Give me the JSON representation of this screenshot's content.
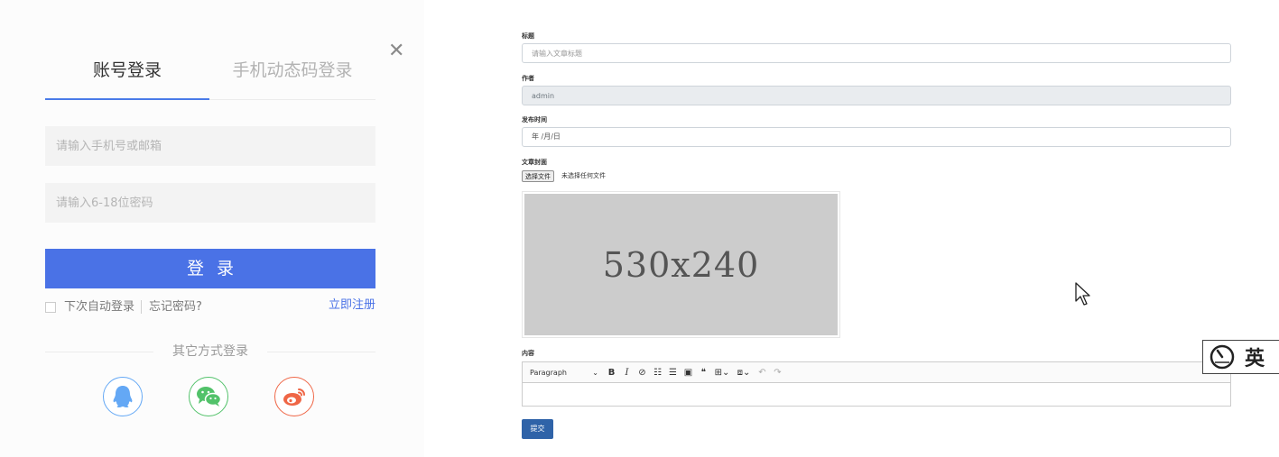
{
  "login": {
    "tabs": [
      {
        "label": "账号登录",
        "active": true
      },
      {
        "label": "手机动态码登录",
        "active": false
      }
    ],
    "close_icon": "close-icon",
    "account_placeholder": "请输入手机号或邮箱",
    "password_placeholder": "请输入6-18位密码",
    "submit_label": "登录",
    "remember_label": "下次自动登录",
    "forgot_label": "忘记密码?",
    "register_label": "立即注册",
    "other_login_label": "其它方式登录",
    "social": [
      {
        "name": "qq",
        "icon": "qq-icon",
        "color": "#64a8f5"
      },
      {
        "name": "wechat",
        "icon": "wechat-icon",
        "color": "#52c26a"
      },
      {
        "name": "weibo",
        "icon": "weibo-icon",
        "color": "#ef6646"
      }
    ],
    "accent_color": "#4a72e6"
  },
  "article_form": {
    "title_label": "标题",
    "title_placeholder": "请输入文章标题",
    "author_label": "作者",
    "author_value": "admin",
    "date_label": "发布时间",
    "date_value": "年 /月/日",
    "cover_label": "文章封面",
    "file_button": "选择文件",
    "file_status": "未选择任何文件",
    "cover_placeholder": "530x240",
    "content_label": "内容",
    "editor_format": "Paragraph",
    "toolbar_icons": [
      "bold-icon",
      "italic-icon",
      "link-icon",
      "bulleted-list-icon",
      "numbered-list-icon",
      "image-icon",
      "blockquote-icon",
      "table-icon",
      "media-icon",
      "undo-icon",
      "redo-icon"
    ],
    "submit_label": "提交",
    "submit_color": "#2f63a8"
  },
  "ime_widget": {
    "label": "英"
  }
}
